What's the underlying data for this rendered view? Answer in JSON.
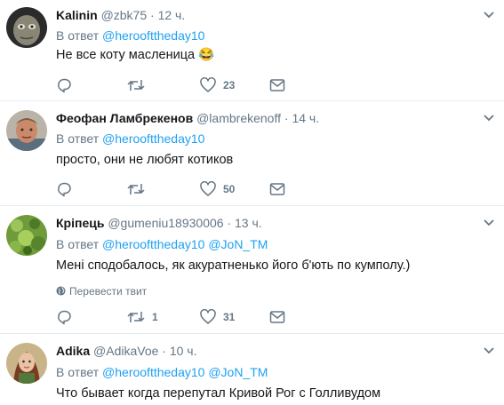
{
  "tweets": [
    {
      "name": "Kalinin",
      "handle": "@zbk75",
      "sep": "·",
      "time": "12 ч.",
      "reply_prefix": "В ответ",
      "mentions": [
        "@heroofttheday10"
      ],
      "text": "Не все коту масленица",
      "emoji": "😂",
      "reply_count": "",
      "retweet_count": "",
      "like_count": "23"
    },
    {
      "name": "Феофан Ламбрекенов",
      "handle": "@lambrekenoff",
      "sep": "·",
      "time": "14 ч.",
      "reply_prefix": "В ответ",
      "mentions": [
        "@heroofttheday10"
      ],
      "text": "просто, они не любят котиков",
      "reply_count": "",
      "retweet_count": "",
      "like_count": "50"
    },
    {
      "name": "Кріпець",
      "handle": "@gumeniu18930006",
      "sep": "·",
      "time": "13 ч.",
      "reply_prefix": "В ответ",
      "mentions": [
        "@heroofttheday10",
        "@JoN_TM"
      ],
      "text": "Мені сподобалось,  як акуратненько його б'ють по кумполу.)",
      "translate": "Перевести твит",
      "reply_count": "",
      "retweet_count": "1",
      "like_count": "31"
    },
    {
      "name": "Adika",
      "handle": "@AdikaVoe",
      "sep": "·",
      "time": "10 ч.",
      "reply_prefix": "В ответ",
      "mentions": [
        "@heroofttheday10",
        "@JoN_TM"
      ],
      "text": "Что бывает когда перепутал Кривой Рог с  Голливудом"
    }
  ],
  "colors": {
    "name": "#14171a",
    "muted": "#657786",
    "mention": "#1da1f2",
    "divider": "#e6ecf0"
  },
  "icons": [
    "reply-icon",
    "retweet-icon",
    "like-icon",
    "dm-icon",
    "chevron-down-icon",
    "globe-icon"
  ]
}
